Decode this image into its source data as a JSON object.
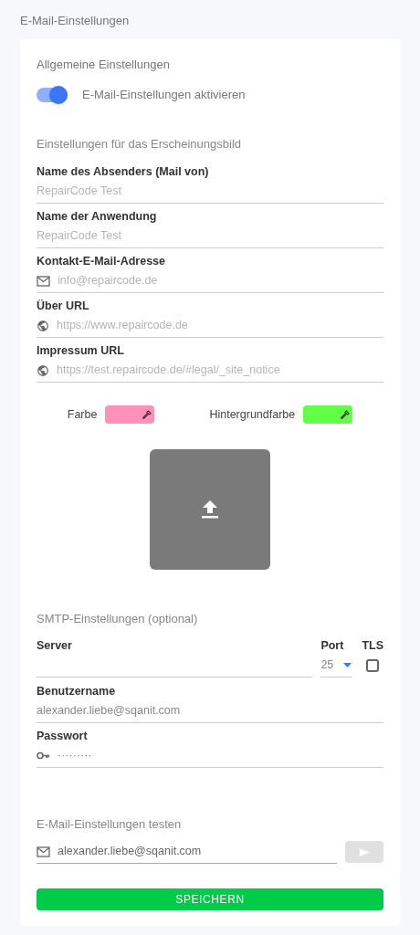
{
  "page_title": "E-Mail-Einstellungen",
  "general": {
    "heading": "Allgemeine Einstellungen",
    "toggle": {
      "label": "E-Mail-Einstellungen aktivieren",
      "on": true
    }
  },
  "appearance": {
    "heading": "Einstellungen für das Erscheinungsbild",
    "fields": [
      {
        "label": "Name des Absenders (Mail von)",
        "placeholder": "RepairCode Test",
        "kind": "text"
      },
      {
        "label": "Name der Anwendung",
        "placeholder": "RepairCode Test",
        "kind": "text"
      },
      {
        "label": "Kontakt-E-Mail-Adresse",
        "placeholder": "info@repaircode.de",
        "kind": "email"
      },
      {
        "label": "Über URL",
        "placeholder": "https://www.repaircode.de",
        "kind": "url"
      },
      {
        "label": "Impressum URL",
        "placeholder": "https://test.repaircode.de/#legal/_site_notice",
        "kind": "url"
      }
    ],
    "colors": [
      {
        "label": "Farbe",
        "color": "#ff91b9"
      },
      {
        "label": "Hintergrundfarbe",
        "color": "#62ff47"
      }
    ]
  },
  "smtp": {
    "heading": "SMTP-Einstellungen (optional)",
    "server_label": "Server",
    "port_label": "Port",
    "port_value": "25",
    "tls_label": "TLS",
    "tls_checked": false,
    "fields": [
      {
        "label": "Benutzername",
        "value": "alexander.liebe@sqanit.com",
        "kind": "text"
      },
      {
        "label": "Passwort",
        "value": "·········",
        "kind": "password"
      }
    ]
  },
  "test": {
    "heading": "E-Mail-Einstellungen testen",
    "value": "alexander.liebe@sqanit.com",
    "send_disabled": true
  },
  "save_button": "SPEICHERN"
}
